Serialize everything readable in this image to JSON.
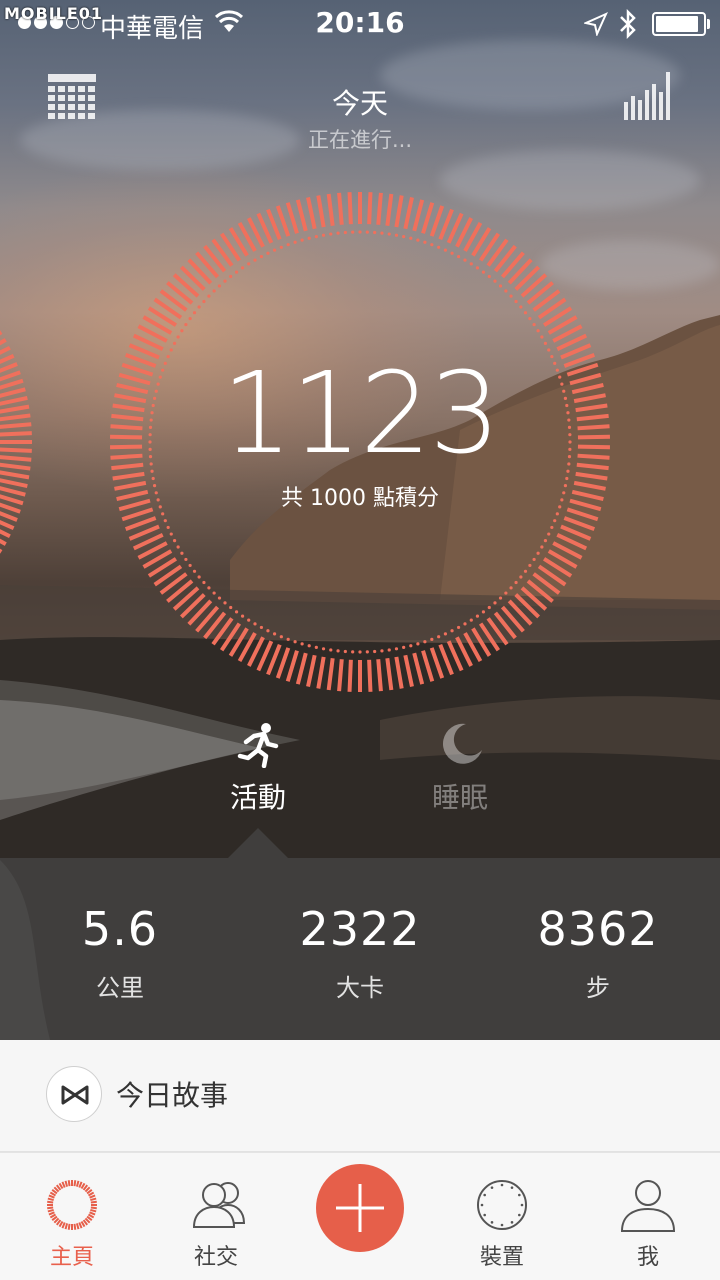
{
  "status_bar": {
    "watermark": "MOBILE01",
    "carrier": "中華電信",
    "time": "20:16",
    "signal_bars_filled": 3,
    "signal_bars_total": 5,
    "battery_level": 0.92
  },
  "header": {
    "title": "今天",
    "subtitle": "正在進行...",
    "left_icon": "calendar-grid-icon",
    "right_icon": "bar-chart-icon"
  },
  "progress_ring": {
    "value": "1123",
    "goal_text": "共 1000 點積分",
    "progress": 1.0,
    "accent_color": "#f0705c"
  },
  "modes": [
    {
      "id": "activity",
      "label": "活動",
      "icon": "running-person-icon",
      "active": true
    },
    {
      "id": "sleep",
      "label": "睡眠",
      "icon": "moon-icon",
      "active": false
    }
  ],
  "stats": [
    {
      "value": "5.6",
      "label": "公里"
    },
    {
      "value": "2322",
      "label": "大卡"
    },
    {
      "value": "8362",
      "label": "步"
    }
  ],
  "story": {
    "title": "今日故事",
    "icon": "bowtie-logo-icon"
  },
  "tabs": [
    {
      "label": "主頁",
      "icon": "home-ring-icon",
      "active": true
    },
    {
      "label": "社交",
      "icon": "people-icon",
      "active": false
    },
    {
      "label": "",
      "icon": "plus-icon",
      "active": false
    },
    {
      "label": "裝置",
      "icon": "device-dial-icon",
      "active": false
    },
    {
      "label": "我",
      "icon": "person-icon",
      "active": false
    }
  ],
  "colors": {
    "accent": "#e65f4a",
    "ring": "#f0705c"
  }
}
